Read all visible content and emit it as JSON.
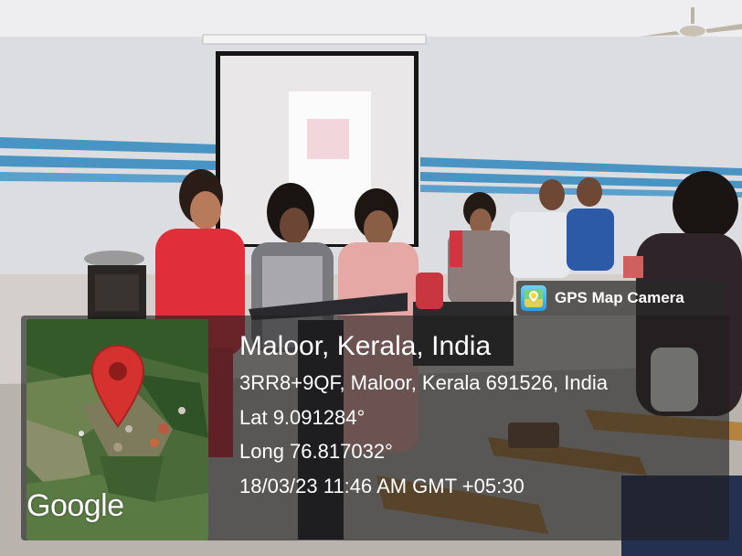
{
  "badge": {
    "label": "GPS Map Camera",
    "icon": "gps-map-camera-icon"
  },
  "map": {
    "logo_text": "Google",
    "marker_icon": "map-pin-icon",
    "marker_color": "#d5312f"
  },
  "location": {
    "title": "Maloor, Kerala, India",
    "address": "3RR8+9QF, Maloor, Kerala 691526, India",
    "latitude": "Lat 9.091284°",
    "longitude": "Long 76.817032°",
    "datetime": "18/03/23 11:46 AM GMT +05:30"
  }
}
